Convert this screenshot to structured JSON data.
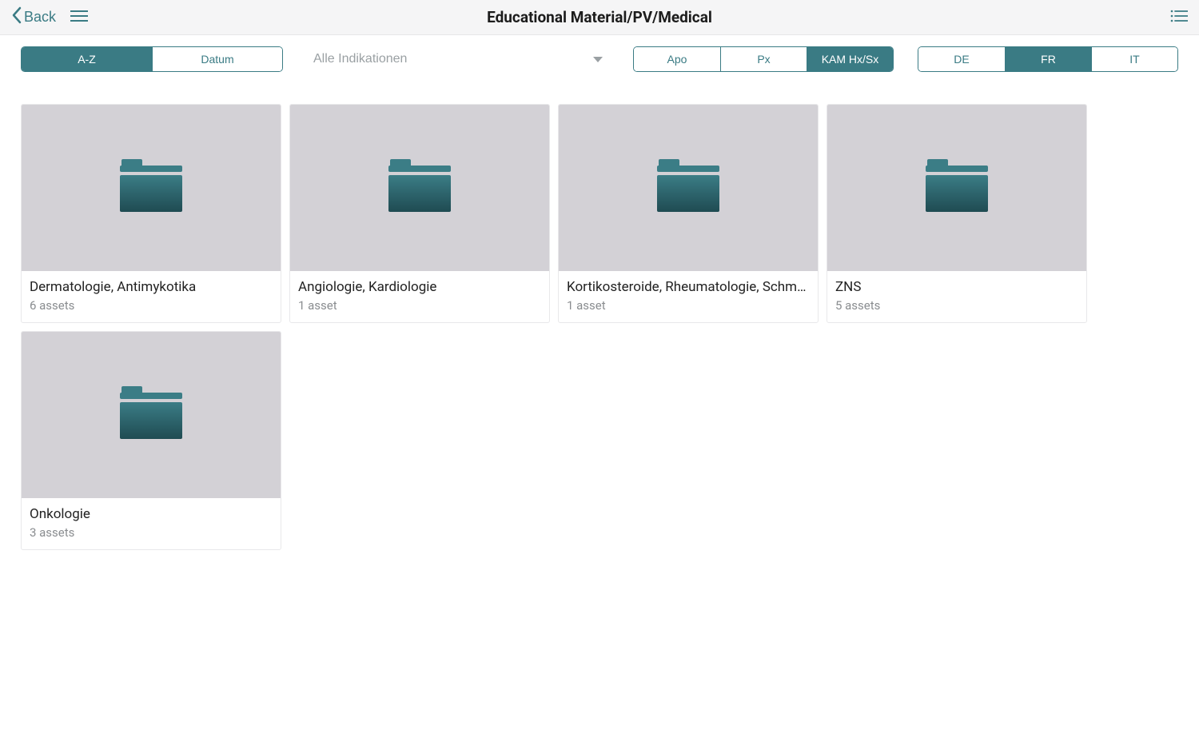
{
  "header": {
    "back_label": "Back",
    "title": "Educational Material/PV/Medical"
  },
  "filters": {
    "sort": {
      "az": "A-Z",
      "date": "Datum",
      "active": "az"
    },
    "dropdown": {
      "label": "Alle Indikationen"
    },
    "channel": {
      "apo": "Apo",
      "px": "Px",
      "kam": "KAM Hx/Sx",
      "active": "kam"
    },
    "lang": {
      "de": "DE",
      "fr": "FR",
      "it": "IT",
      "active": "fr"
    }
  },
  "folders": [
    {
      "title": "Dermatologie, Antimykotika",
      "subtitle": "6 assets"
    },
    {
      "title": "Angiologie, Kardiologie",
      "subtitle": "1 asset"
    },
    {
      "title": "Kortikosteroide, Rheumatologie, Schme…",
      "subtitle": "1 asset"
    },
    {
      "title": "ZNS",
      "subtitle": "5 assets"
    },
    {
      "title": "Onkologie",
      "subtitle": "3 assets"
    }
  ]
}
